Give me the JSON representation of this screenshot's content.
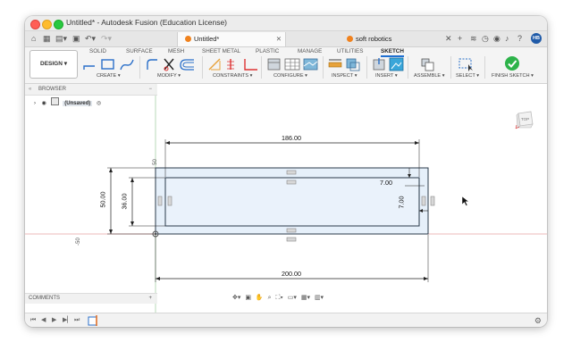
{
  "window": {
    "title": "Untitled* - Autodesk Fusion (Education License)"
  },
  "tabbar": {
    "tabs": [
      {
        "label": "Untitled*",
        "active": true
      },
      {
        "label": "soft robotics",
        "active": false
      }
    ],
    "avatar": "HB"
  },
  "ribbon": {
    "workspace": "DESIGN",
    "tabs": [
      "SOLID",
      "SURFACE",
      "MESH",
      "SHEET METAL",
      "PLASTIC",
      "MANAGE",
      "UTILITIES",
      "SKETCH"
    ],
    "active_tab": "SKETCH",
    "groups": [
      "CREATE",
      "MODIFY",
      "CONSTRAINTS",
      "CONFIGURE",
      "INSPECT",
      "INSERT",
      "ASSEMBLE",
      "SELECT",
      "FINISH SKETCH"
    ]
  },
  "browser": {
    "header": "BROWSER",
    "item_label": "(Unsaved)"
  },
  "comments": {
    "label": "COMMENTS"
  },
  "viewcube": {
    "label": "TOP"
  },
  "sketch": {
    "dimensions": {
      "overall_width": "186.00",
      "outer_width": "200.00",
      "outer_height": "50.00",
      "inner_height": "36.00",
      "offset_top": "7.00",
      "offset_right": "7.00",
      "axis_y": "50",
      "axis_neg": "-50"
    }
  },
  "colors": {
    "accent": "#1f6fd1",
    "finish": "#2db34a",
    "sketch_fill": "#e6f0fa",
    "sketch_line": "#2a3a4a",
    "fusion_orange": "#f0821e"
  }
}
